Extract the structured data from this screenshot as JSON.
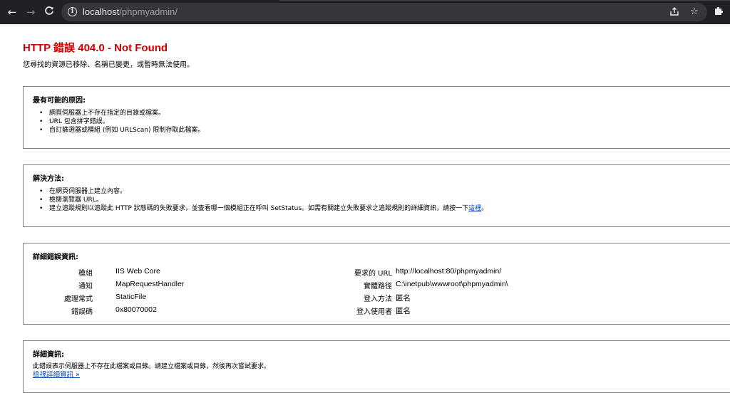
{
  "browser": {
    "url_host": "localhost",
    "url_path": "/phpmyadmin/",
    "icons": {
      "back": "arrow-left-icon",
      "forward": "arrow-right-icon",
      "reload": "reload-icon",
      "info": "info-icon",
      "share": "share-icon",
      "bookmark": "star-icon",
      "extensions": "puzzle-icon"
    }
  },
  "error": {
    "title": "HTTP 錯誤 404.0 - Not Found",
    "subtitle": "您尋找的資源已移除、名稱已變更，或暫時無法使用。"
  },
  "causes": {
    "heading": "最有可能的原因:",
    "items": [
      "網頁伺服器上不存在指定的目錄或檔案。",
      "URL 包含拼字錯誤。",
      "自訂篩選器或模組 (例如 URLScan) 限制存取此檔案。"
    ]
  },
  "solutions": {
    "heading": "解決方法:",
    "items": [
      "在網頁伺服器上建立內容。",
      "檢閱瀏覽器 URL。"
    ],
    "item3_text": "建立追蹤規則以追蹤此 HTTP 狀態碼的失敗要求，並查看哪一個模組正在呼叫 SetStatus。如需有關建立失敗要求之追蹤規則的詳細資訊，請按一下",
    "item3_link": "這裡",
    "item3_tail": "。"
  },
  "detailed_error": {
    "heading": "詳細錯誤資訊:",
    "left": [
      {
        "label": "模組",
        "value": "IIS Web Core"
      },
      {
        "label": "通知",
        "value": "MapRequestHandler"
      },
      {
        "label": "處理常式",
        "value": "StaticFile"
      },
      {
        "label": "錯誤碼",
        "value": "0x80070002"
      }
    ],
    "right": [
      {
        "label": "要求的 URL",
        "value": "http://localhost:80/phpmyadmin/"
      },
      {
        "label": "實體路徑",
        "value": "C:\\inetpub\\wwwroot\\phpmyadmin\\"
      },
      {
        "label": "登入方法",
        "value": "匿名"
      },
      {
        "label": "登入使用者",
        "value": "匿名"
      }
    ]
  },
  "more_info": {
    "heading": "詳細資訊:",
    "text": "此錯誤表示伺服器上不存在此檔案或目錄。請建立檔案或目錄，然後再次嘗試要求。",
    "link": "檢視詳細資訊 »"
  }
}
